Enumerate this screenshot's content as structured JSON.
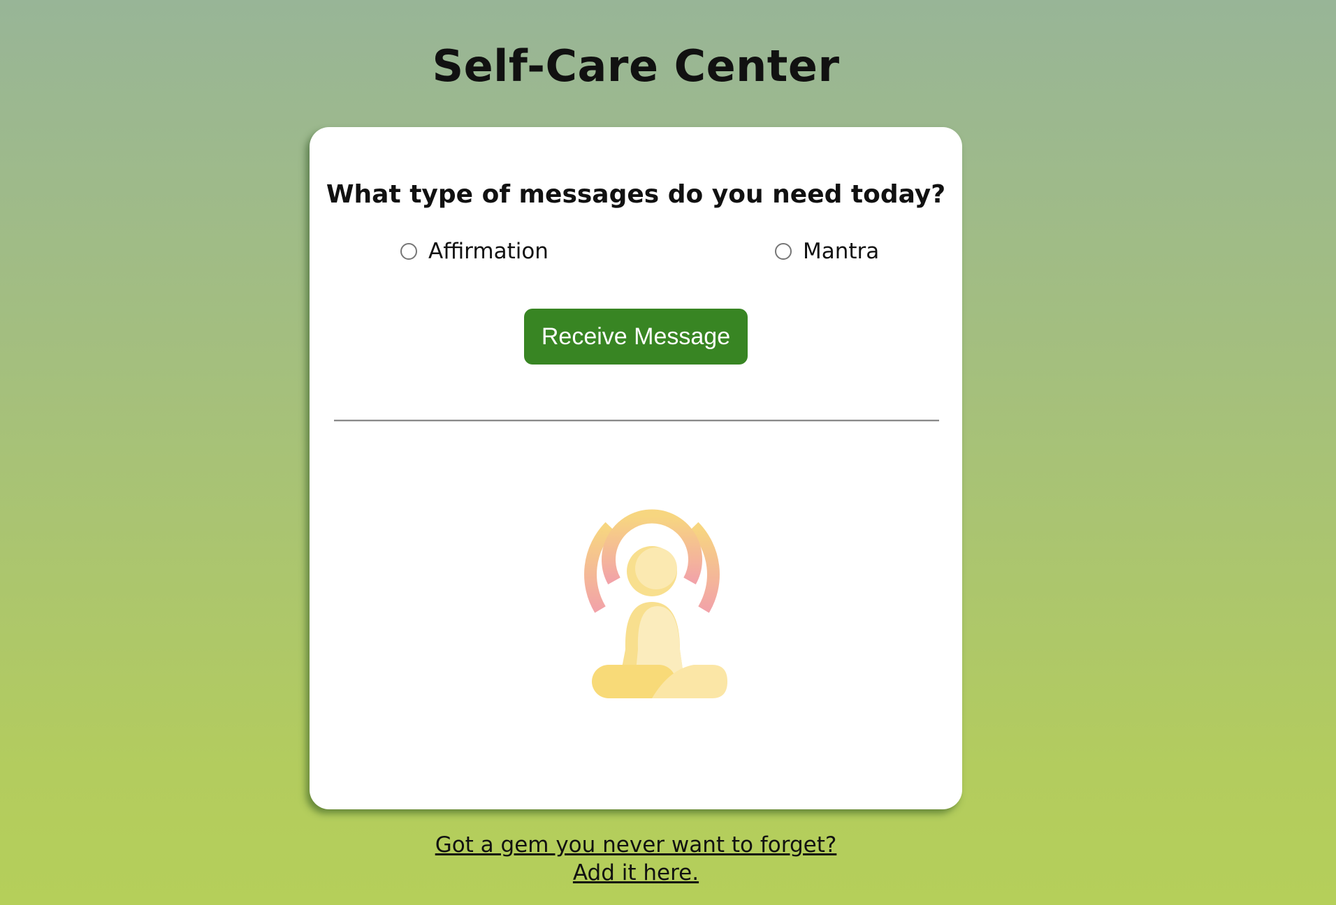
{
  "header": {
    "title": "Self-Care Center"
  },
  "card": {
    "question": "What type of messages do you need today?",
    "options": [
      {
        "label": "Affirmation",
        "selected": false
      },
      {
        "label": "Mantra",
        "selected": false
      }
    ],
    "button_label": "Receive Message",
    "illustration_icon": "meditation-icon"
  },
  "footer": {
    "link_line1": "Got a gem you never want to forget?",
    "link_line2": "Add it here."
  },
  "colors": {
    "button_bg": "#388523",
    "background_top": "#98b597",
    "background_bottom": "#b5cf5a",
    "card_bg": "#ffffff"
  }
}
